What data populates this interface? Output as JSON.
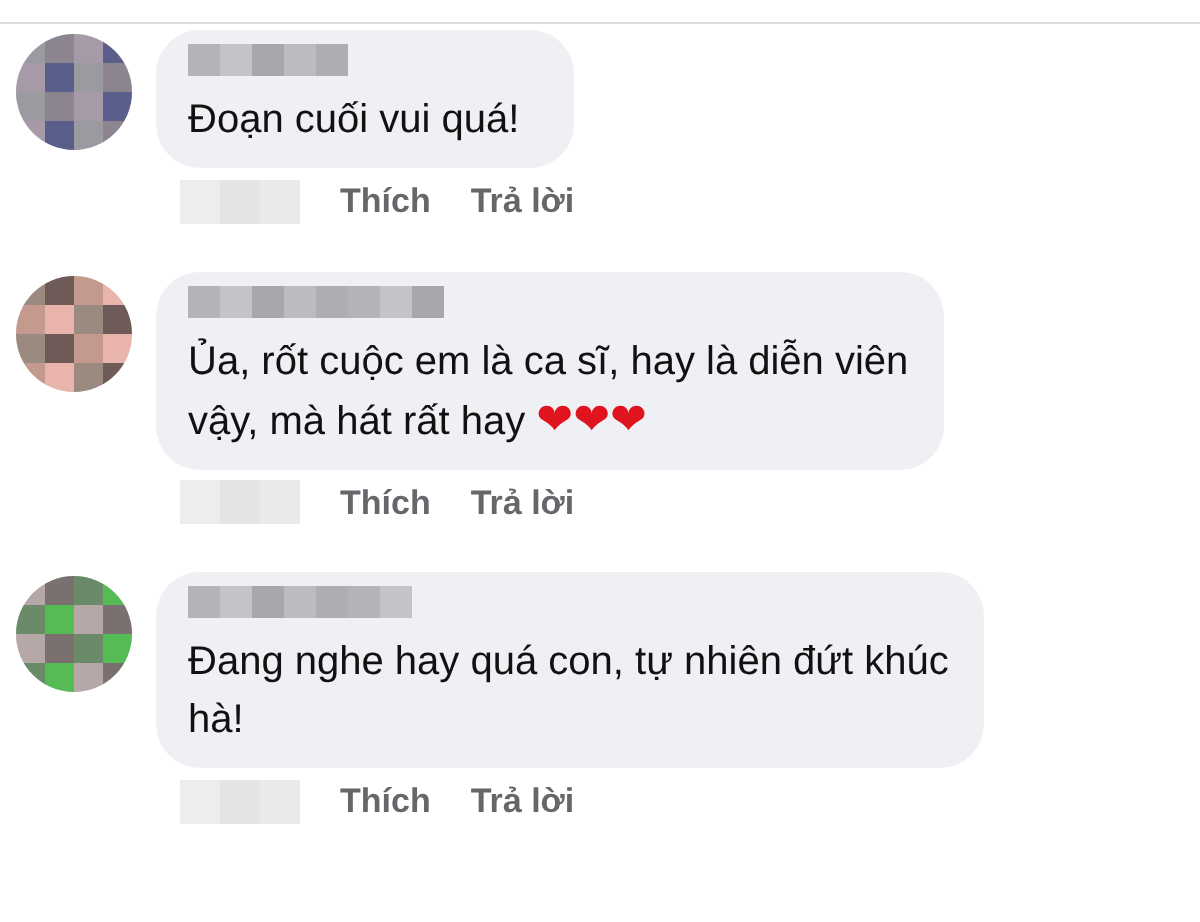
{
  "comments": [
    {
      "lines": [
        "Đoạn cuối vui quá!"
      ],
      "actions": [
        "Thích",
        "Trả lời"
      ]
    },
    {
      "lines": [
        "Ủa, rốt cuộc em là ca sĩ, hay là diễn viên",
        "vậy, mà hát rất hay"
      ],
      "emoji": [
        "❤",
        "❤",
        "❤"
      ],
      "actions": [
        "Thích",
        "Trả lời"
      ]
    },
    {
      "lines": [
        "Đang nghe hay quá con, tự nhiên đứt khúc",
        "hà!"
      ],
      "actions": [
        "Thích",
        "Trả lời"
      ]
    }
  ]
}
